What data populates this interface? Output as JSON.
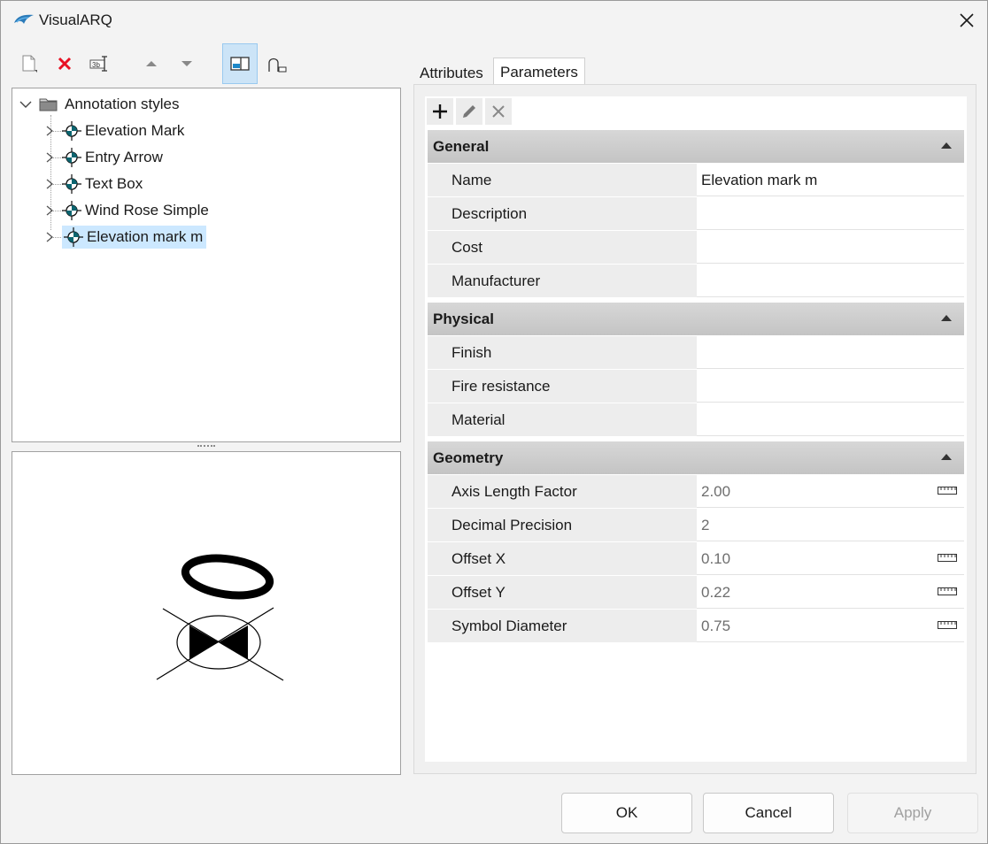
{
  "window": {
    "title": "VisualARQ"
  },
  "toolbar": {
    "buttons": [
      {
        "name": "new",
        "icon": "new-document-icon"
      },
      {
        "name": "delete",
        "icon": "delete-x-icon"
      },
      {
        "name": "rename",
        "icon": "rename-icon"
      },
      {
        "name": "move-up",
        "icon": "triangle-up-icon"
      },
      {
        "name": "move-down",
        "icon": "triangle-down-icon"
      },
      {
        "name": "preview-toggle",
        "icon": "preview-panel-icon"
      },
      {
        "name": "insert",
        "icon": "insert-curve-icon"
      }
    ]
  },
  "tree": {
    "root_label": "Annotation styles",
    "items": [
      {
        "label": "Elevation Mark"
      },
      {
        "label": "Entry Arrow"
      },
      {
        "label": "Text Box"
      },
      {
        "label": "Wind Rose Simple"
      },
      {
        "label": "Elevation mark m"
      }
    ],
    "selected_index": 4
  },
  "tabs": [
    {
      "label": "Attributes",
      "active": false
    },
    {
      "label": "Parameters",
      "active": true
    }
  ],
  "sections": [
    {
      "title": "General",
      "rows": [
        {
          "name": "Name",
          "value": "Elevation mark m"
        },
        {
          "name": "Description",
          "value": ""
        },
        {
          "name": "Cost",
          "value": ""
        },
        {
          "name": "Manufacturer",
          "value": ""
        }
      ]
    },
    {
      "title": "Physical",
      "rows": [
        {
          "name": "Finish",
          "value": ""
        },
        {
          "name": "Fire resistance",
          "value": ""
        },
        {
          "name": "Material",
          "value": ""
        }
      ]
    },
    {
      "title": "Geometry",
      "rows": [
        {
          "name": "Axis Length Factor",
          "value": "2.00"
        },
        {
          "name": "Decimal Precision",
          "value": "2"
        },
        {
          "name": "Offset X",
          "value": "0.10"
        },
        {
          "name": "Offset Y",
          "value": "0.22"
        },
        {
          "name": "Symbol Diameter",
          "value": "0.75"
        }
      ]
    }
  ],
  "buttons": {
    "ok": "OK",
    "cancel": "Cancel",
    "apply": "Apply"
  },
  "colors": {
    "accent": "#cce8ff",
    "delete": "#e81123",
    "section": "#c8c8c8"
  }
}
